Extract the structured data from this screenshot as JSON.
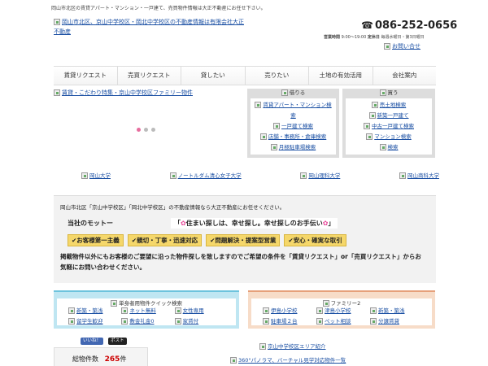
{
  "header": {
    "tagline": "岡山市北区の賃貸アパート・マンション・一戸建て、売買物件情報は大正不動産にお任せ下さい。",
    "logo_alt": "岡山市北区、京山中学校区・岡北中学校区の不動産情報は有限会社大正不動産",
    "phone_icon": "☎",
    "phone": "086-252-0656",
    "hours_label": "営業時間",
    "hours": "9:00～19:00",
    "closed_label": "定休日",
    "closed": "毎週水曜日・第3日曜日",
    "inquiry": "お問い合せ"
  },
  "nav": {
    "items": [
      "賃貸リクエスト",
      "売買リクエスト",
      "貸したい",
      "売りたい",
      "土地の有効活用",
      "会社案内"
    ]
  },
  "hero": {
    "slide_alt": "賃貸・こだわり特集・京山中学校区ファミリー物件"
  },
  "rent_panel": {
    "title": "借りる",
    "links": [
      "賃貸アパート・マンション検索",
      "一戸建て検索",
      "店舗・事務所・倉庫検索",
      "月極駐車場検索"
    ]
  },
  "buy_panel": {
    "title": "買う",
    "links": [
      "売土地検索",
      "新築一戸建て",
      "中古一戸建て検索",
      "マンション検索",
      "検索"
    ]
  },
  "universities": [
    "岡山大学",
    "ノートルダム清心女子大学",
    "岡山理科大学",
    "岡山商科大学"
  ],
  "info": {
    "lead": "岡山市北区「京山中学校区」「岡北中学校区」の不動産情報なら大正不動産にお任せください。",
    "motto_label": "当社のモットー",
    "motto_sparkle": "✿",
    "motto": "住まい探しは、幸せ探し。幸せ探しのお手伝い",
    "check": "✔",
    "badges": [
      "お客様第一主義",
      "親切・丁寧・迅速対応",
      "問題解決・提案型営業",
      "安心・確実な取引"
    ],
    "body": "掲載物件以外にもお客様のご要望に沿った物件探しを致しますのでご希望の条件を「賃貸リクエスト」or「売買リクエスト」からお気軽にお問い合わせください。"
  },
  "single_search": {
    "title": "単身者用物件クイック検索",
    "links": [
      "新築・築浅",
      "ネット無料",
      "女性専用",
      "留学生歓迎",
      "敷金礼金0",
      "家賃付"
    ]
  },
  "family_search": {
    "title": "ファミリー2",
    "links": [
      "伊島小学校",
      "津島小学校",
      "新築・築浅",
      "駐車場２台",
      "ペット相談",
      "分譲賃貸"
    ]
  },
  "social": {
    "like": "いいね！",
    "post": "ポスト"
  },
  "count": {
    "label": "総物件数",
    "value": "265",
    "unit": "件"
  },
  "links": {
    "area": "京山中学校区エリア紹介",
    "vr": "360°パノラマ、バーチャル見学対応物件一覧"
  },
  "colors": {
    "accent_pink": "#e76d9e",
    "badge_yellow": "#f5d76a",
    "blue_panel": "#bfe6f2",
    "orange_panel": "#f7dcc8",
    "count_red": "#cc0000"
  }
}
